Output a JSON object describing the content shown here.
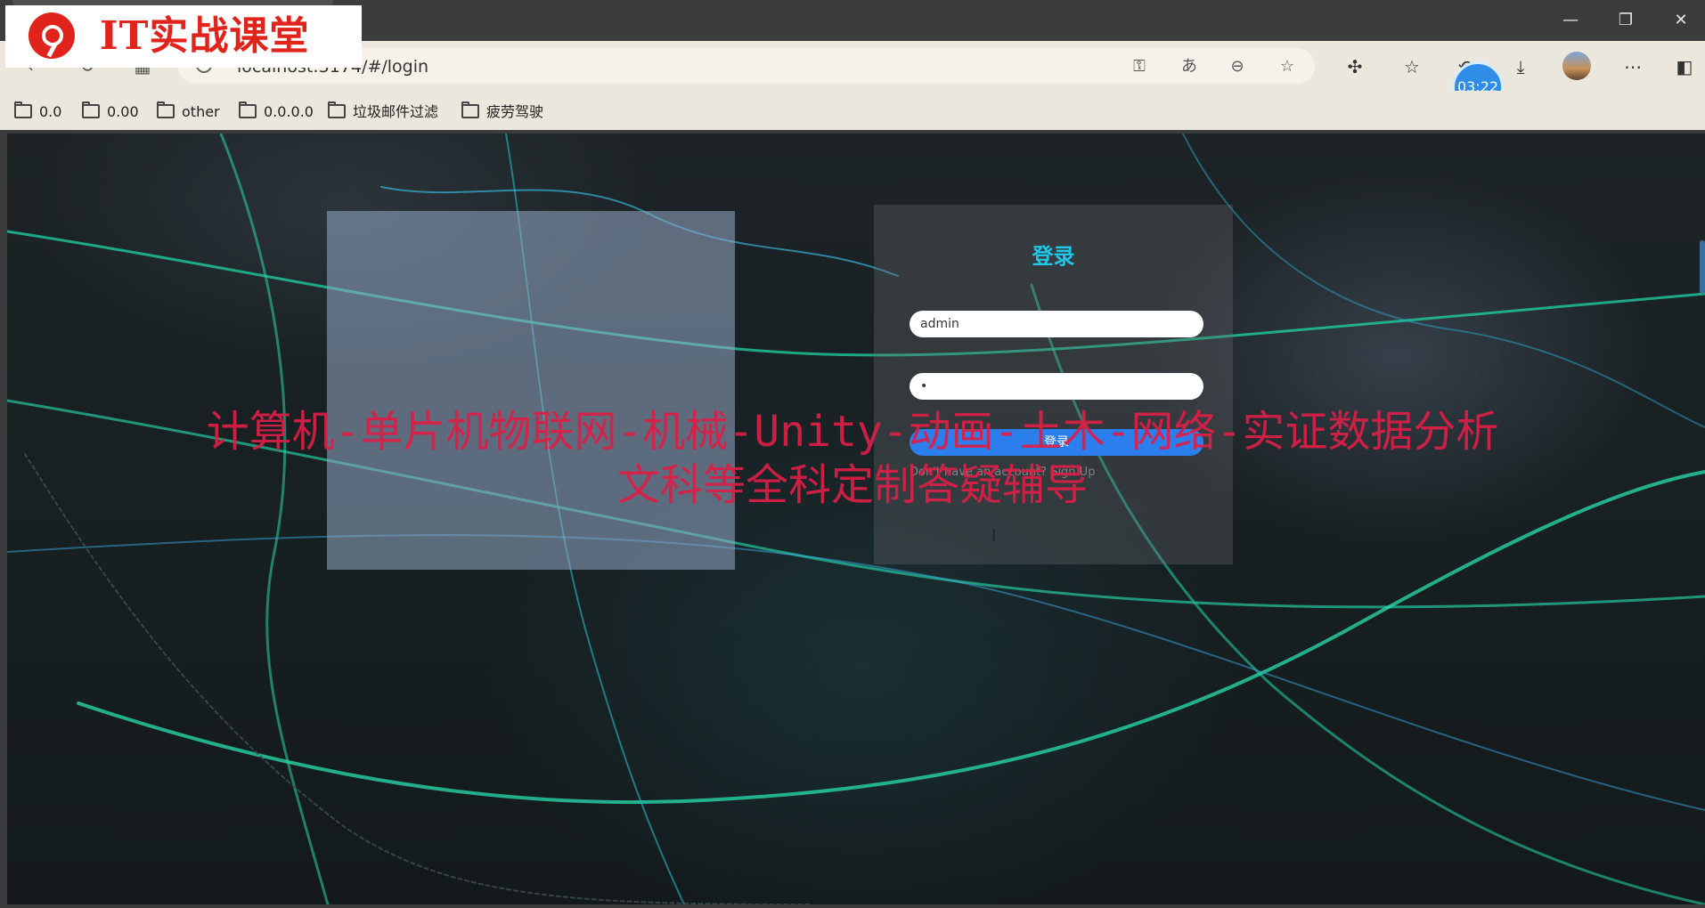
{
  "browser": {
    "window_controls": {
      "minimize": "—",
      "restore": "❐",
      "close": "✕"
    },
    "nav_icons": [
      "back-icon",
      "refresh-icon",
      "grid-icon"
    ],
    "address": {
      "url": "localhost:5174/#/login"
    },
    "address_icons": [
      "key-icon",
      "read-aloud-icon",
      "zoom-out-icon",
      "star-icon"
    ],
    "toolbar_icons": [
      "extensions-icon",
      "favorites-icon",
      "history-icon",
      "download-icon",
      "more-icon",
      "sidebar-icon"
    ],
    "timer": "03:22"
  },
  "bookmarks": [
    {
      "label": "0.0"
    },
    {
      "label": "0.00"
    },
    {
      "label": "other"
    },
    {
      "label": "0.0.0.0"
    },
    {
      "label": "垃圾邮件过滤"
    },
    {
      "label": "疲劳驾驶"
    }
  ],
  "watermark": {
    "text": "IT实战课堂"
  },
  "login": {
    "title": "登录",
    "username_value": "admin",
    "password_value": "•",
    "button_label": "登录",
    "signup_text": "Don't have an account? Sign Up"
  },
  "overlay": {
    "line1": "计算机-单片机物联网-机械-Unity-动画-土木-网络-实证数据分析",
    "line2": "文科等全科定制答疑辅导"
  },
  "colors": {
    "title_accent": "#1ec6e8",
    "button": "#2b7fec",
    "overlay_text": "#dc1e46",
    "logo_red": "#e1241b"
  }
}
